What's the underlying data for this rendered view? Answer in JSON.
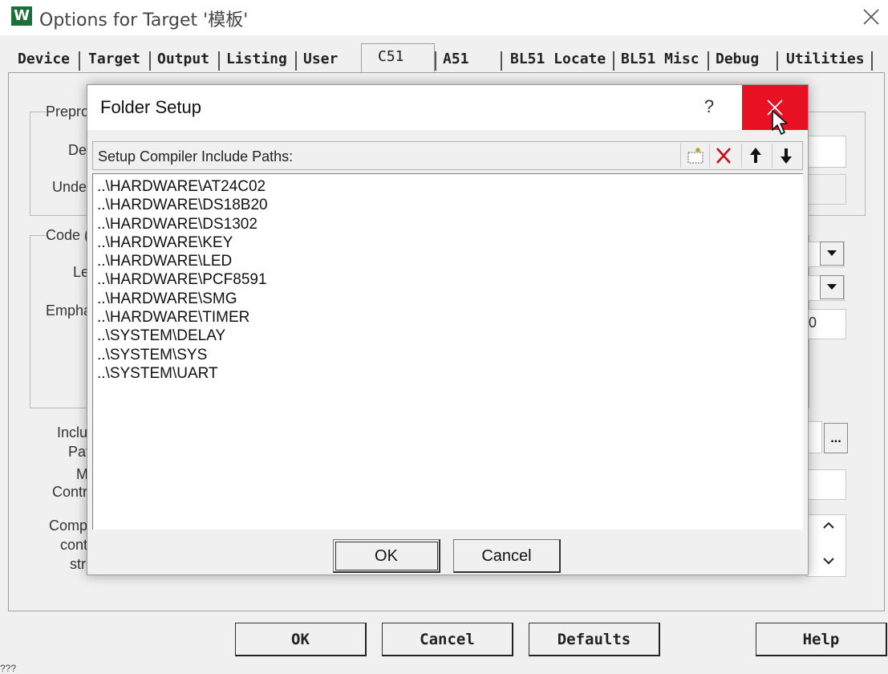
{
  "window": {
    "title": "Options for Target '模板'",
    "icon_letter": "W",
    "icon_color": "#1c6e3a"
  },
  "tabs": [
    {
      "label": "Device"
    },
    {
      "label": "Target"
    },
    {
      "label": "Output"
    },
    {
      "label": "Listing"
    },
    {
      "label": "User"
    },
    {
      "label": "C51",
      "active": true
    },
    {
      "label": "A51"
    },
    {
      "label": "BL51 Locate"
    },
    {
      "label": "BL51 Misc"
    },
    {
      "label": "Debug"
    },
    {
      "label": "Utilities"
    }
  ],
  "background": {
    "preproc_group": "Prepro",
    "define_label": "De",
    "undefine_label": "Unde",
    "code_group": "Code (",
    "level_label": "Le",
    "emphasis_label": "Empha",
    "emphasis_value_fragment": "0",
    "include_label_1": "Inclu",
    "include_label_2": "Pat",
    "misc_label_1": "M",
    "misc_label_2": "Contr",
    "compiler_label_1": "Comp",
    "compiler_label_2": "cont",
    "compiler_label_3": "stri",
    "browse_button": "..."
  },
  "buttons": {
    "ok": "OK",
    "cancel": "Cancel",
    "defaults": "Defaults",
    "help": "Help"
  },
  "status_fragment": "???",
  "dialog": {
    "title": "Folder Setup",
    "help_label": "?",
    "close_color": "#e81123",
    "list_label": "Setup Compiler Include Paths:",
    "toolbar_icons": [
      "new-folder-icon",
      "delete-icon",
      "move-up-icon",
      "move-down-icon"
    ],
    "paths": [
      "..\\HARDWARE\\AT24C02",
      "..\\HARDWARE\\DS18B20",
      "..\\HARDWARE\\DS1302",
      "..\\HARDWARE\\KEY",
      "..\\HARDWARE\\LED",
      "..\\HARDWARE\\PCF8591",
      "..\\HARDWARE\\SMG",
      "..\\HARDWARE\\TIMER",
      "..\\SYSTEM\\DELAY",
      "..\\SYSTEM\\SYS",
      "..\\SYSTEM\\UART"
    ],
    "ok_label": "OK",
    "cancel_label": "Cancel"
  }
}
